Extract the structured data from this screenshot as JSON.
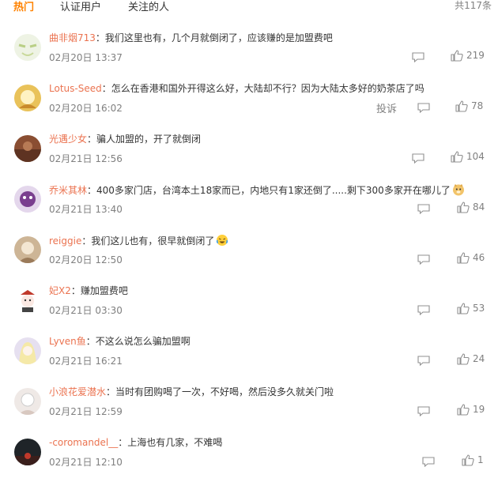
{
  "tabs": [
    "热门",
    "认证用户",
    "关注的人"
  ],
  "total": "共117条",
  "colors": {
    "accent": "#ff8200",
    "username": "#eb7350",
    "meta": "#808080"
  },
  "report_label": "投诉",
  "comments": [
    {
      "user": "曲非烟713",
      "sep": "：",
      "text": "我们这里也有，几个月就倒闭了，应该赚的是加盟费吧",
      "time": "02月20日 13:37",
      "likes": "219"
    },
    {
      "user": "Lotus-Seed",
      "sep": "：",
      "text": "怎么在香港和国外开得这么好，大陆却不行？因为大陆太多好的奶茶店了吗",
      "time": "02月20日 16:02",
      "likes": "78"
    },
    {
      "user": "光遇少女",
      "sep": "：",
      "text": "骗人加盟的，开了就倒闭",
      "time": "02月21日 12:56",
      "likes": "104"
    },
    {
      "user": "乔米其林",
      "sep": "：",
      "text": "400多家门店，台湾本土18家而已，内地只有1家还倒了.....剩下300多家开在哪儿了",
      "time": "02月21日 13:40",
      "likes": "84",
      "emoji": "doge"
    },
    {
      "user": "reiggie",
      "sep": "：",
      "text": "我们这儿也有，很早就倒闭了",
      "time": "02月20日 12:50",
      "likes": "46",
      "emoji": "laugh-cry"
    },
    {
      "user": "妃X2",
      "sep": "：",
      "text": "赚加盟费吧",
      "time": "02月21日 03:30",
      "likes": "53"
    },
    {
      "user": "Lyven鱼",
      "sep": "：",
      "text": "不这么说怎么骗加盟啊",
      "time": "02月21日 16:21",
      "likes": "24"
    },
    {
      "user": "小浪花爱潜水",
      "sep": "：",
      "text": "当时有团购喝了一次，不好喝，然后没多久就关门啦",
      "time": "02月21日 12:59",
      "likes": "19"
    },
    {
      "user": "-coromandel__",
      "sep": "：",
      "text": "上海也有几家，不难喝",
      "time": "02月21日 12:10",
      "likes": "1"
    }
  ]
}
